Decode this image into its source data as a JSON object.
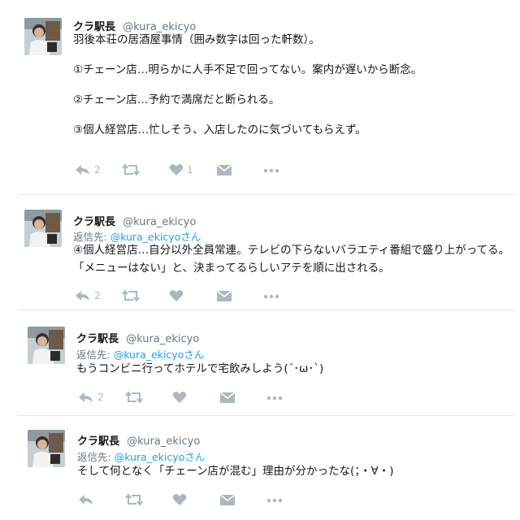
{
  "tweets": [
    {
      "name": "クラ駅長",
      "handle": "@kura_ekicyo",
      "reply_label": "",
      "reply_handle": "",
      "lines": [
        "羽後本荘の居酒屋事情（囲み数字は回った軒数）。",
        "①チェーン店…明らかに人手不足で回ってない。案内が遅いから断念。",
        "②チェーン店…予約で満席だと断られる。",
        "③個人経営店…忙しそう、入店したのに気づいてもらえず。"
      ],
      "reply_count": "2",
      "retweet_count": "",
      "like_count": "1"
    },
    {
      "name": "クラ駅長",
      "handle": "@kura_ekicyo",
      "reply_label": "返信先:",
      "reply_handle": "@kura_ekicyoさん",
      "lines": [
        "④個人経営店…自分以外全員常連。テレビの下らないバラエティ番組で盛り上がってる。",
        "「メニューはない」と、決まってるらしいアテを順に出される。"
      ],
      "reply_count": "2",
      "retweet_count": "",
      "like_count": ""
    },
    {
      "name": "クラ駅長",
      "handle": "@kura_ekicyo",
      "reply_label": "返信先:",
      "reply_handle": "@kura_ekicyoさん",
      "lines": [
        "もうコンビニ行ってホテルで宅飲みしよう(´･ω･`)"
      ],
      "reply_count": "2",
      "retweet_count": "",
      "like_count": ""
    },
    {
      "name": "クラ駅長",
      "handle": "@kura_ekicyo",
      "reply_label": "返信先:",
      "reply_handle": "@kura_ekicyoさん",
      "lines": [
        "そして何となく「チェーン店が混む」理由が分かったな(；・∀・)"
      ],
      "reply_count": "",
      "retweet_count": "",
      "like_count": ""
    }
  ],
  "icons": {
    "reply": "reply-icon",
    "retweet": "retweet-icon",
    "like": "heart-icon",
    "dm": "envelope-icon",
    "more": "more-dots-icon"
  },
  "colors": {
    "text": "#14171a",
    "muted": "#657786",
    "link": "#1da1f2",
    "icon": "#aab8c2",
    "divider": "#e1e8ed"
  }
}
